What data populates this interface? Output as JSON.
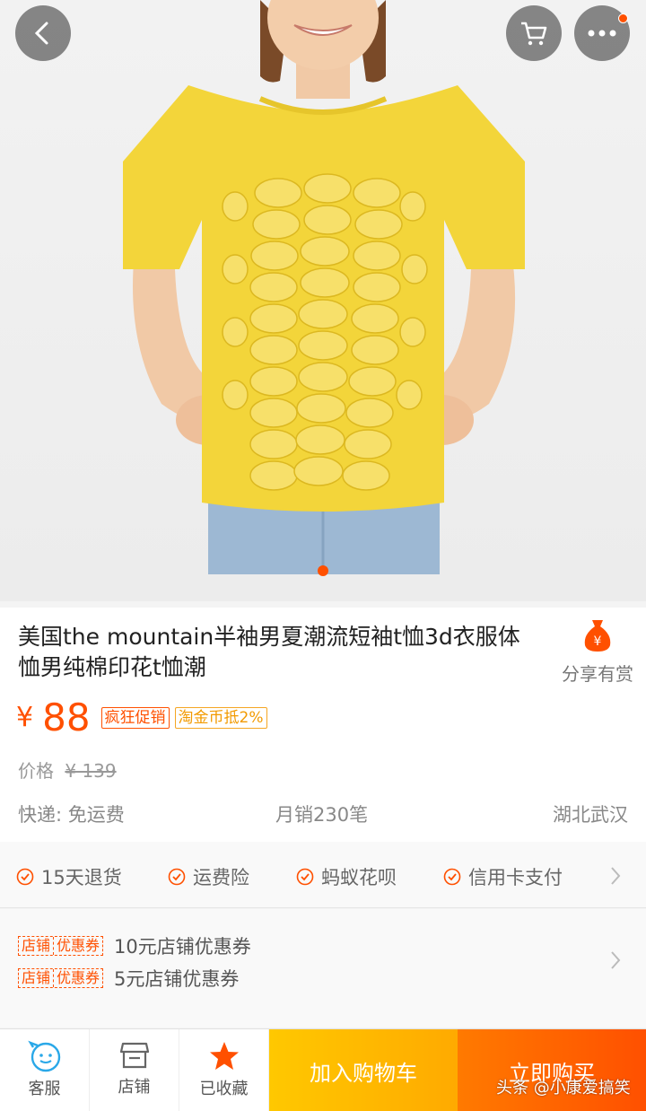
{
  "product": {
    "title": "美国the mountain半袖男夏潮流短袖t恤3d衣服体恤男纯棉印花t恤潮",
    "price_currency": "¥",
    "price": "88",
    "tags": [
      "疯狂促销",
      "淘金币抵2%"
    ],
    "original_price_label": "价格",
    "original_price": "¥ 139",
    "shipping": "快递: 免运费",
    "monthly_sales": "月销230笔",
    "location": "湖北武汉"
  },
  "share": {
    "label": "分享有赏",
    "icon": "money-bag-icon"
  },
  "services": [
    "15天退货",
    "运费险",
    "蚂蚁花呗",
    "信用卡支付"
  ],
  "coupons": [
    {
      "badge_left": "店铺",
      "badge_right": "优惠券",
      "text": "10元店铺优惠券"
    },
    {
      "badge_left": "店铺",
      "badge_right": "优惠券",
      "text": "5元店铺优惠券"
    }
  ],
  "bottom_bar": {
    "tabs": [
      {
        "label": "客服",
        "icon": "customer-service-icon"
      },
      {
        "label": "店铺",
        "icon": "shop-icon"
      },
      {
        "label": "已收藏",
        "icon": "star-icon"
      }
    ],
    "add_to_cart": "加入购物车",
    "buy_now": "立即购买"
  },
  "watermark": "头条 @小康爱搞笑",
  "colors": {
    "accent": "#ff5000",
    "cart_button": "#ffb400",
    "buy_button": "#ff6a00"
  }
}
